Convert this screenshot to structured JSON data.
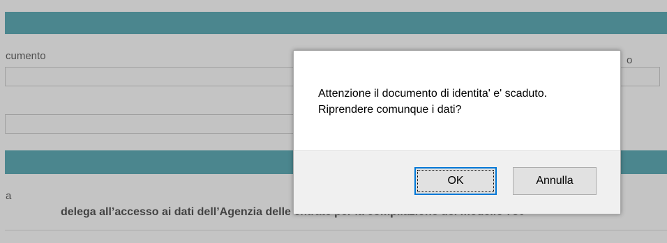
{
  "background": {
    "labels": {
      "documento": "cumento",
      "right_label": "o",
      "left_small": "a"
    },
    "heading": "delega all’accesso ai dati dell’Agenzia delle entrate per la compilazione del modello 730"
  },
  "dialog": {
    "message_line1": "Attenzione il documento di identita' e' scaduto.",
    "message_line2": "Riprendere comunque i dati?",
    "ok_label": "OK",
    "cancel_label": "Annulla"
  },
  "colors": {
    "teal": "#2f8f9b",
    "focus_blue": "#0078d7"
  }
}
